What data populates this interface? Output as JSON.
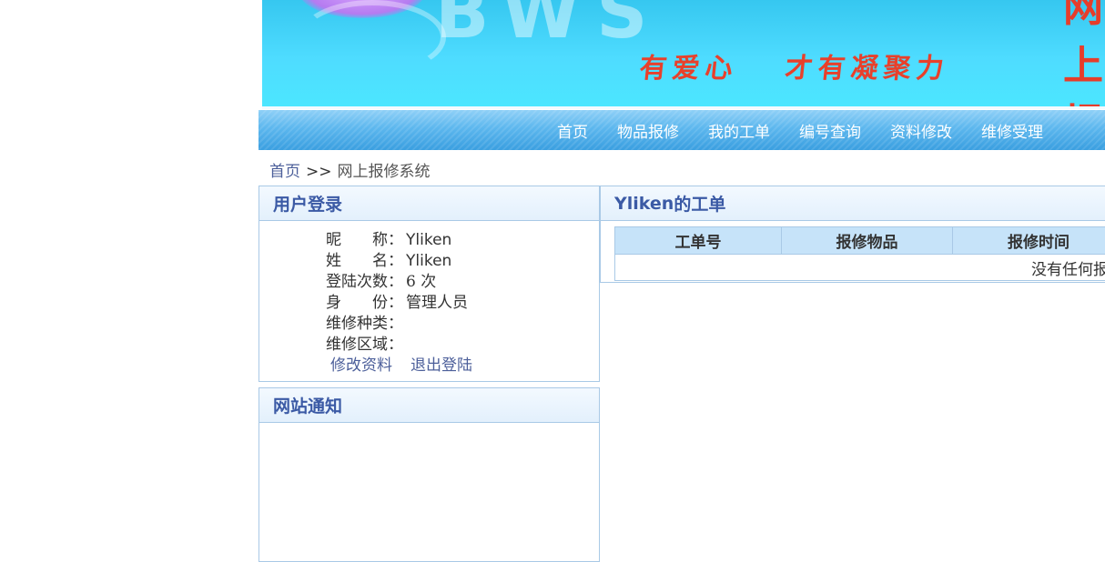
{
  "banner": {
    "logo_text": "BWS",
    "title_fragment": "网上报修",
    "slogan_left": "有爱心",
    "slogan_right": "才有凝聚力"
  },
  "nav": {
    "items": [
      "首页",
      "物品报修",
      "我的工单",
      "编号查询",
      "资料修改",
      "维修受理"
    ]
  },
  "breadcrumb": {
    "home": "首页",
    "separator": ">>",
    "current": "网上报修系统"
  },
  "login_panel": {
    "title": "用户登录",
    "rows": [
      {
        "label": "昵　　称：",
        "value": "Yliken"
      },
      {
        "label": "姓　　名：",
        "value": "Yliken"
      },
      {
        "label": "登陆次数：",
        "value": "6 次"
      },
      {
        "label": "身　　份：",
        "value": "管理人员"
      },
      {
        "label": "维修种类：",
        "value": ""
      },
      {
        "label": "维修区域：",
        "value": ""
      }
    ],
    "edit_link": "修改资料",
    "logout_link": "退出登陆"
  },
  "notice_panel": {
    "title": "网站通知"
  },
  "orders_panel": {
    "user": "Yliken",
    "title_suffix": "的工单",
    "columns": [
      "工单号",
      "报修物品",
      "报修时间"
    ],
    "empty_message": "没有任何报修"
  },
  "colors": {
    "panel_title": "#3b5aa5",
    "nav_blue": "#3a9fe0",
    "banner_cyan": "#4edcff",
    "slogan_red": "#e8402b",
    "table_header": "#c6e3f9",
    "border": "#a9c9e6"
  }
}
